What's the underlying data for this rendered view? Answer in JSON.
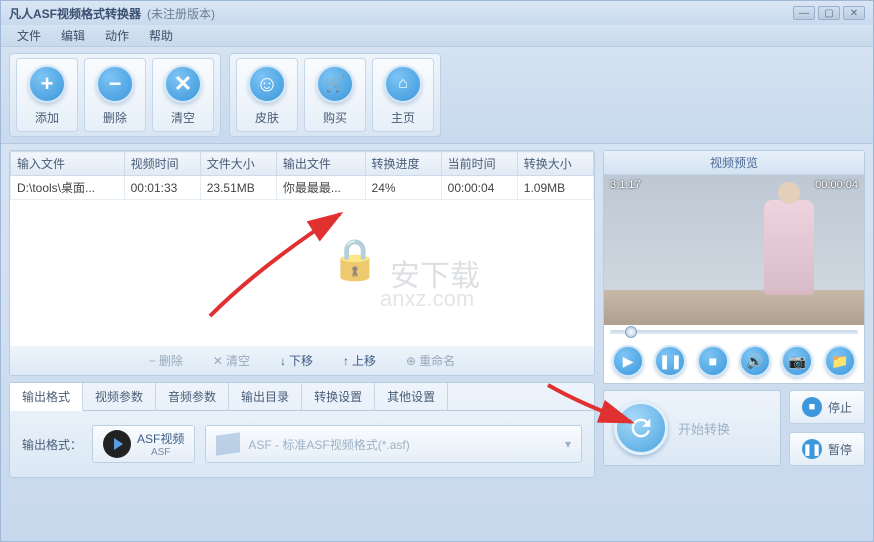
{
  "titlebar": {
    "main": "凡人ASF视频格式转换器",
    "sub": "(未注册版本)"
  },
  "menu": {
    "file": "文件",
    "edit": "编辑",
    "action": "动作",
    "help": "帮助"
  },
  "toolbar": {
    "add": "添加",
    "delete": "删除",
    "clear": "清空",
    "skin": "皮肤",
    "buy": "购买",
    "home": "主页"
  },
  "table": {
    "headers": {
      "input": "输入文件",
      "vtime": "视频时间",
      "fsize": "文件大小",
      "output": "输出文件",
      "progress": "转换进度",
      "ctime": "当前时间",
      "csize": "转换大小"
    },
    "rows": [
      {
        "input": "D:\\tools\\桌面...",
        "vtime": "00:01:33",
        "fsize": "23.51MB",
        "output": "你最最最...",
        "progress": "24%",
        "ctime": "00:00:04",
        "csize": "1.09MB"
      }
    ]
  },
  "table_actions": {
    "delete": "删除",
    "clear": "清空",
    "down": "下移",
    "up": "上移",
    "rename": "重命名"
  },
  "tabs": {
    "format": "输出格式",
    "vparam": "视频参数",
    "aparam": "音频参数",
    "outdir": "输出目录",
    "conv": "转换设置",
    "other": "其他设置"
  },
  "format_panel": {
    "label": "输出格式：",
    "btn_text": "ASF视频",
    "btn_sub": "ASF",
    "select_text": "ASF - 标准ASF视频格式(*.asf)"
  },
  "preview": {
    "title": "视频预览",
    "ts_left": "3:1:17",
    "ts_right": "00:00:04"
  },
  "action": {
    "start": "开始转换",
    "stop": "停止",
    "pause": "暂停"
  },
  "watermark": {
    "shield": "🛡",
    "text": "安下载",
    "url": "anxz.com"
  }
}
